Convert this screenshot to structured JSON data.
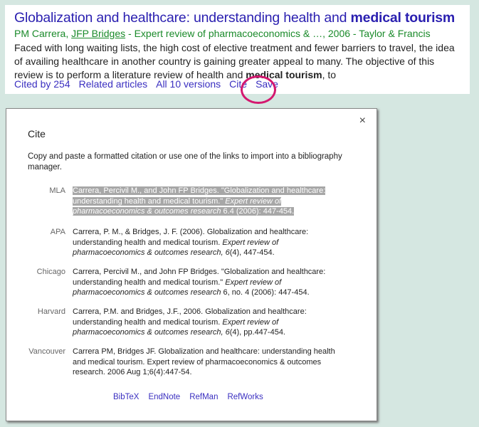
{
  "result": {
    "title_plain": "Globalization and healthcare: understanding health and ",
    "title_bold": "medical tourism",
    "author1": "PM Carrera, ",
    "author2": "JFP Bridges",
    "source": " - Expert review of pharmacoeconomics & …, 2006 - Taylor & Francis",
    "snippet_plain": "Faced with long waiting lists, the high cost of elective treatment and fewer barriers to travel, the idea of availing healthcare in another country is gaining greater appeal to many. The objective of this review is to perform a literature review of health and ",
    "snippet_bold": "medical tourism",
    "snippet_end": ", to",
    "links": [
      "Cited by 254",
      "Related articles",
      "All 10 versions",
      "Cite",
      "Save"
    ],
    "highlight_color": "#d4186f"
  },
  "dialog": {
    "close": "×",
    "title": "Cite",
    "intro": "Copy and paste a formatted citation or use one of the links to import into a bibliography manager.",
    "citations": [
      {
        "style": "MLA",
        "pre": "Carrera, Percivil M., and John FP Bridges. \"Globalization and healthcare: understanding health and medical tourism.\" ",
        "ital": "Expert review of pharmacoeconomics & outcomes research",
        "post": " 6.4 (2006): 447-454.",
        "selected": true
      },
      {
        "style": "APA",
        "pre": "Carrera, P. M., & Bridges, J. F. (2006). Globalization and healthcare: understanding health and medical tourism. ",
        "ital": "Expert review of pharmacoeconomics & outcomes research, 6",
        "post": "(4), 447-454."
      },
      {
        "style": "Chicago",
        "pre": "Carrera, Percivil M., and John FP Bridges. \"Globalization and healthcare: understanding health and medical tourism.\" ",
        "ital": "Expert review of pharmacoeconomics & outcomes research",
        "post": " 6, no. 4 (2006): 447-454."
      },
      {
        "style": "Harvard",
        "pre": "Carrera, P.M. and Bridges, J.F., 2006. Globalization and healthcare: understanding health and medical tourism. ",
        "ital": "Expert review of pharmacoeconomics & outcomes research, 6",
        "post": "(4), pp.447-454."
      },
      {
        "style": "Vancouver",
        "pre": "Carrera PM, Bridges JF. Globalization and healthcare: understanding health and medical tourism. Expert review of pharmacoeconomics & outcomes research. 2006 Aug 1;6(4):447-54.",
        "ital": "",
        "post": ""
      }
    ],
    "export_links": [
      "BibTeX",
      "EndNote",
      "RefMan",
      "RefWorks"
    ]
  }
}
